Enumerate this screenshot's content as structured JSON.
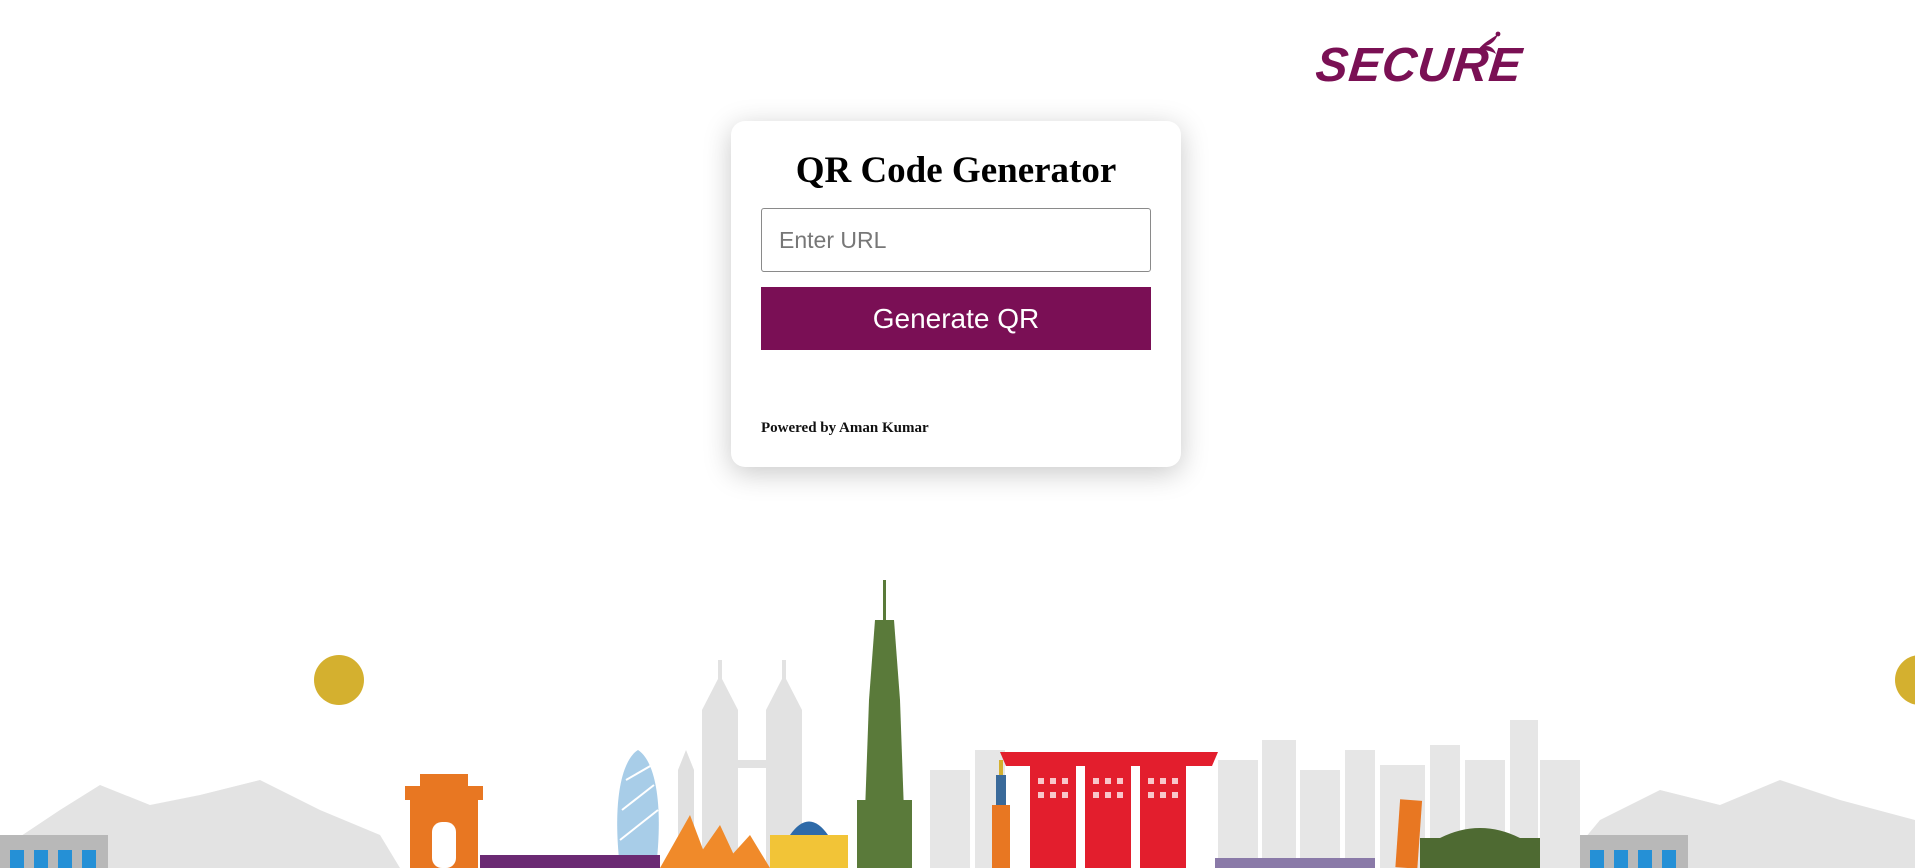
{
  "brand": {
    "logo_text": "SECURE",
    "accent_color": "#7a0f55",
    "sun_color": "#d4b02f"
  },
  "card": {
    "title": "QR Code Generator",
    "url_input": {
      "placeholder": "Enter URL",
      "value": ""
    },
    "generate_button_label": "Generate QR",
    "powered_by": "Powered by Aman Kumar"
  },
  "illustration": {
    "name": "world-landmarks-skyline",
    "icons": [
      "india-gate-icon",
      "gherkin-tower-icon",
      "sydney-opera-house-icon",
      "burj-khalifa-icon",
      "marina-bay-sands-icon",
      "leaning-tower-icon",
      "petronas-towers-icon"
    ]
  }
}
